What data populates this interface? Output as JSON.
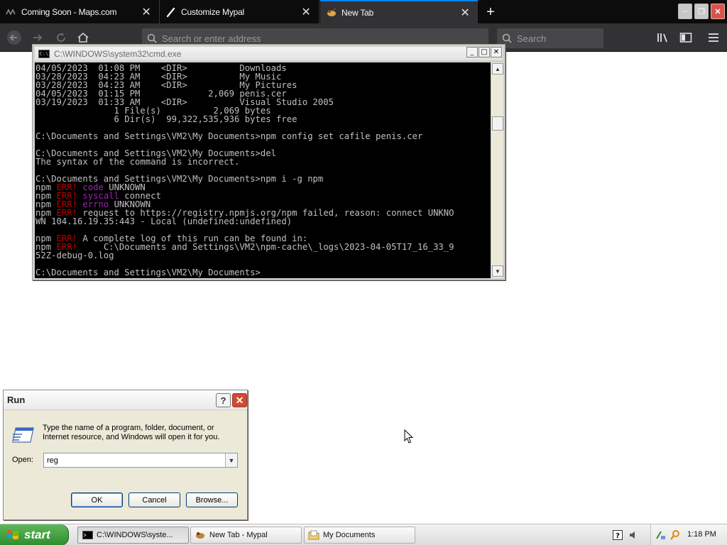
{
  "browser": {
    "tabs": [
      {
        "title": "Coming Soon - Maps.com",
        "icon": "maps-favicon"
      },
      {
        "title": "Customize Mypal",
        "icon": "brush-icon"
      },
      {
        "title": "New Tab",
        "icon": "mypal-favicon",
        "active": true
      }
    ],
    "url_placeholder": "Search or enter address",
    "search_placeholder": "Search"
  },
  "cmd": {
    "title": "C:\\WINDOWS\\system32\\cmd.exe",
    "lines": [
      [
        {
          "t": "04/05/2023  01:08 PM    <DIR>          Downloads"
        }
      ],
      [
        {
          "t": "03/28/2023  04:23 AM    <DIR>          My Music"
        }
      ],
      [
        {
          "t": "03/28/2023  04:23 AM    <DIR>          My Pictures"
        }
      ],
      [
        {
          "t": "04/05/2023  01:15 PM             2,069 penis.cer"
        }
      ],
      [
        {
          "t": "03/19/2023  01:33 AM    <DIR>          Visual Studio 2005"
        }
      ],
      [
        {
          "t": "               1 File(s)          2,069 bytes"
        }
      ],
      [
        {
          "t": "               6 Dir(s)  99,322,535,936 bytes free"
        }
      ],
      [
        {
          "t": ""
        }
      ],
      [
        {
          "t": "C:\\Documents and Settings\\VM2\\My Documents>npm config set cafile penis.cer"
        }
      ],
      [
        {
          "t": ""
        }
      ],
      [
        {
          "t": "C:\\Documents and Settings\\VM2\\My Documents>del"
        }
      ],
      [
        {
          "t": "The syntax of the command is incorrect."
        }
      ],
      [
        {
          "t": ""
        }
      ],
      [
        {
          "t": "C:\\Documents and Settings\\VM2\\My Documents>npm i -g npm"
        }
      ],
      [
        {
          "t": "npm "
        },
        {
          "t": "ERR!",
          "c": "err"
        },
        {
          "t": " "
        },
        {
          "t": "code",
          "c": "mag"
        },
        {
          "t": " UNKNOWN"
        }
      ],
      [
        {
          "t": "npm "
        },
        {
          "t": "ERR!",
          "c": "err"
        },
        {
          "t": " "
        },
        {
          "t": "syscall",
          "c": "mag"
        },
        {
          "t": " connect"
        }
      ],
      [
        {
          "t": "npm "
        },
        {
          "t": "ERR!",
          "c": "err"
        },
        {
          "t": " "
        },
        {
          "t": "errno",
          "c": "mag"
        },
        {
          "t": " UNKNOWN"
        }
      ],
      [
        {
          "t": "npm "
        },
        {
          "t": "ERR!",
          "c": "err"
        },
        {
          "t": " request to https://registry.npmjs.org/npm failed, reason: connect UNKNO"
        }
      ],
      [
        {
          "t": "WN 104.16.19.35:443 - Local (undefined:undefined)"
        }
      ],
      [
        {
          "t": ""
        }
      ],
      [
        {
          "t": "npm "
        },
        {
          "t": "ERR!",
          "c": "err"
        },
        {
          "t": " A complete log of this run can be found in:"
        }
      ],
      [
        {
          "t": "npm "
        },
        {
          "t": "ERR!",
          "c": "err"
        },
        {
          "t": "     C:\\Documents and Settings\\VM2\\npm-cache\\_logs\\2023-04-05T17_16_33_9"
        }
      ],
      [
        {
          "t": "52Z-debug-0.log"
        }
      ],
      [
        {
          "t": ""
        }
      ],
      [
        {
          "t": "C:\\Documents and Settings\\VM2\\My Documents>"
        }
      ]
    ]
  },
  "run_dialog": {
    "title": "Run",
    "help_label": "?",
    "description": "Type the name of a program, folder, document, or Internet resource, and Windows will open it for you.",
    "open_label": "Open:",
    "open_value": "reg",
    "ok_label": "OK",
    "cancel_label": "Cancel",
    "browse_label": "Browse..."
  },
  "taskbar": {
    "start_label": "start",
    "tasks": [
      {
        "label": "C:\\WINDOWS\\syste...",
        "icon": "cmd-icon",
        "active": true
      },
      {
        "label": "New Tab - Mypal",
        "icon": "mypal-icon"
      },
      {
        "label": "My Documents",
        "icon": "folder-icon"
      }
    ],
    "clock": "1:18 PM"
  }
}
